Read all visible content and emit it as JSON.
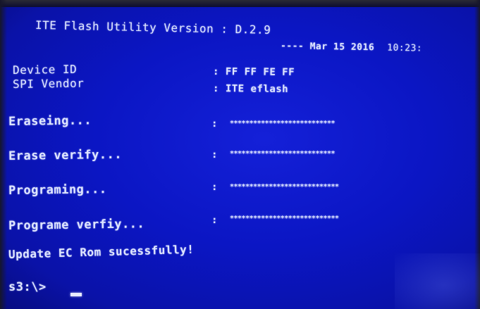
{
  "title": "ITE Flash Utility Version : D.2.9",
  "date_line": "---- Mar 15 2016",
  "time": "10:23:",
  "info": [
    {
      "label": "Device ID",
      "value": ": FF FF FE FF"
    },
    {
      "label": "SPI Vendor",
      "value": ": ITE eflash"
    }
  ],
  "steps": [
    {
      "label": "Eraseing...",
      "sep": ":",
      "progress": "***************************"
    },
    {
      "label": "Erase verify...",
      "sep": ":",
      "progress": "***************************"
    },
    {
      "label": "Programing...",
      "sep": ":",
      "progress": "****************************"
    },
    {
      "label": "Programe verfiy...",
      "sep": ":",
      "progress": "****************************"
    }
  ],
  "result_message": "Update EC Rom sucessfully!",
  "prompt": "s3:\\>"
}
